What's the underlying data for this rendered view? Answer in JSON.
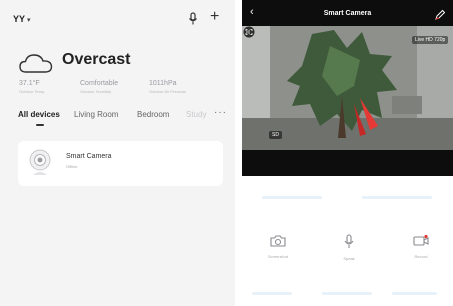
{
  "left_panel": {
    "home_name": "YY",
    "weather": {
      "condition": "Overcast",
      "stats": [
        {
          "value": "37.1°F",
          "label": "Outdoor Temp."
        },
        {
          "value": "Comfortable",
          "label": "Outdoor Humidity"
        },
        {
          "value": "1011hPa",
          "label": "Outdoor Air Pressure"
        }
      ]
    },
    "tabs": [
      "All devices",
      "Living Room",
      "Bedroom",
      "Study"
    ],
    "tab_more": "···",
    "device": {
      "name": "Smart Camera",
      "status": "Offline"
    }
  },
  "right_panel": {
    "title": "Smart Camera",
    "video_badge": "Live HD 720p",
    "video_quality": "SD",
    "actions": [
      {
        "label": "Screenshot",
        "icon": "camera-icon"
      },
      {
        "label": "Speak",
        "icon": "microphone-icon"
      },
      {
        "label": "Record",
        "icon": "video-record-icon"
      }
    ]
  },
  "colors": {
    "accent": "#e53935",
    "dark_bar": "#0d0d0e",
    "left_bg": "#f4f4f5",
    "action_icon": "#8a8a8f"
  }
}
